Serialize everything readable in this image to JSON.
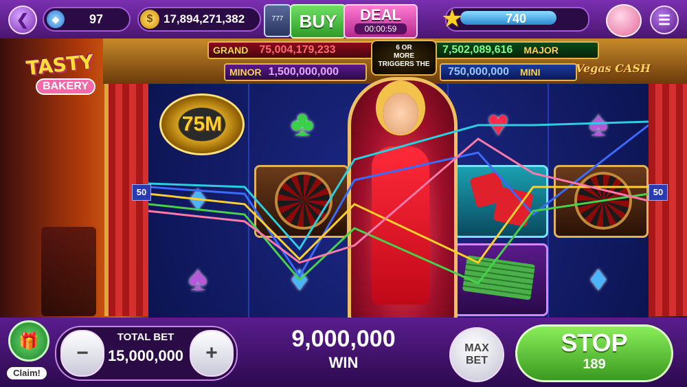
{
  "top": {
    "gems": "97",
    "coins": "17,894,271,382",
    "buy_label": "BUY",
    "deal_label": "DEAL",
    "deal_timer": "00:00:59",
    "stars": "740"
  },
  "jackpots": {
    "grand_label": "GRAND",
    "grand_value": "75,004,179,233",
    "major_label": "MAJOR",
    "major_value": "7,502,089,616",
    "minor_label": "MINOR",
    "minor_value": "1,500,000,000",
    "mini_label": "MINI",
    "mini_value": "750,000,000",
    "center_note_1": "6 OR",
    "center_note_2": "MORE",
    "center_note_3": "TRIGGERS THE"
  },
  "game": {
    "logo_line1": "TASTY",
    "logo_line2": "BAKERY",
    "vegas_cash": "Vegas CASH",
    "chip_label": "75M",
    "payline_left": "50",
    "payline_right": "50"
  },
  "bottom": {
    "claim_label": "Claim!",
    "total_bet_label": "TOTAL BET",
    "total_bet_value": "15,000,000",
    "minus_label": "−",
    "plus_label": "+",
    "win_value": "9,000,000",
    "win_label": "WIN",
    "max_bet_line1": "MAX",
    "max_bet_line2": "BET",
    "stop_label": "STOP",
    "stop_count": "189"
  },
  "colors": {
    "accent_purple": "#7a2fb0",
    "buy_green": "#3fbf3a",
    "deal_pink": "#e04fb0",
    "stop_green": "#5ac53c"
  }
}
